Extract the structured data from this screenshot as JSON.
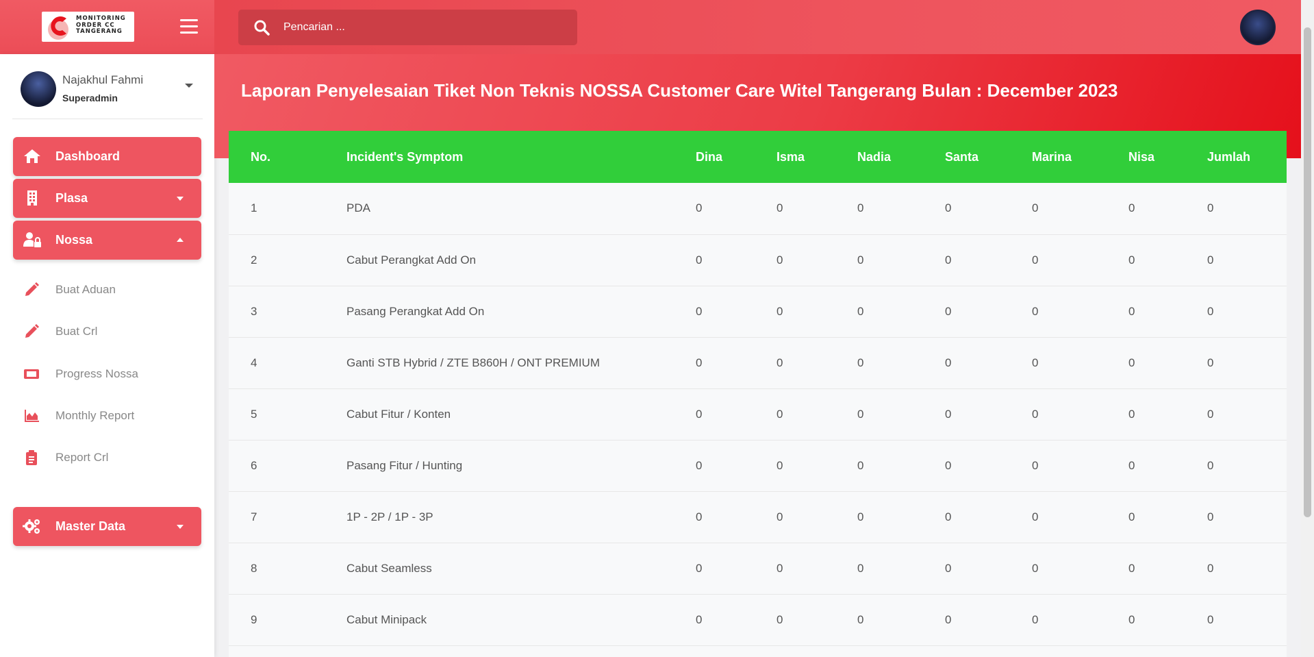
{
  "brand": {
    "logo_text": "MONITORING ORDER CC TANGERANG"
  },
  "search": {
    "placeholder": "Pencarian ..."
  },
  "user": {
    "name": "Najakhul Fahmi",
    "role": "Superadmin"
  },
  "nav": {
    "dashboard": "Dashboard",
    "plasa": "Plasa",
    "nossa": "Nossa",
    "master_data": "Master Data"
  },
  "submenu": [
    {
      "label": "Buat Aduan",
      "icon": "pencil-icon"
    },
    {
      "label": "Buat Crl",
      "icon": "pencil-icon"
    },
    {
      "label": "Progress Nossa",
      "icon": "ticket-icon"
    },
    {
      "label": "Monthly Report",
      "icon": "area-chart-icon"
    },
    {
      "label": "Report Crl",
      "icon": "clipboard-icon"
    }
  ],
  "page": {
    "title": "Laporan Penyelesaian Tiket Non Teknis NOSSA Customer Care Witel Tangerang Bulan : December 2023"
  },
  "table": {
    "headers": [
      "No.",
      "Incident's Symptom",
      "Dina",
      "Isma",
      "Nadia",
      "Santa",
      "Marina",
      "Nisa",
      "Jumlah"
    ],
    "rows": [
      [
        "1",
        "PDA",
        "0",
        "0",
        "0",
        "0",
        "0",
        "0",
        "0"
      ],
      [
        "2",
        "Cabut Perangkat Add On",
        "0",
        "0",
        "0",
        "0",
        "0",
        "0",
        "0"
      ],
      [
        "3",
        "Pasang Perangkat Add On",
        "0",
        "0",
        "0",
        "0",
        "0",
        "0",
        "0"
      ],
      [
        "4",
        "Ganti STB Hybrid / ZTE B860H / ONT PREMIUM",
        "0",
        "0",
        "0",
        "0",
        "0",
        "0",
        "0"
      ],
      [
        "5",
        "Cabut Fitur / Konten",
        "0",
        "0",
        "0",
        "0",
        "0",
        "0",
        "0"
      ],
      [
        "6",
        "Pasang Fitur / Hunting",
        "0",
        "0",
        "0",
        "0",
        "0",
        "0",
        "0"
      ],
      [
        "7",
        "1P - 2P / 1P - 3P",
        "0",
        "0",
        "0",
        "0",
        "0",
        "0",
        "0"
      ],
      [
        "8",
        "Cabut Seamless",
        "0",
        "0",
        "0",
        "0",
        "0",
        "0",
        "0"
      ],
      [
        "9",
        "Cabut Minipack",
        "0",
        "0",
        "0",
        "0",
        "0",
        "0",
        "0"
      ]
    ]
  },
  "colors": {
    "primary": "#ee5560",
    "header_green": "#31ce3a",
    "icon_red": "#e8505b"
  }
}
